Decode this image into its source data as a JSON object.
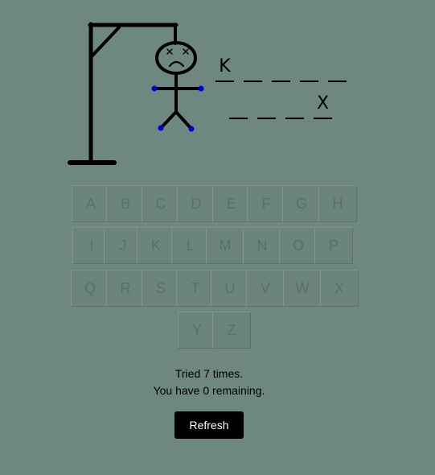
{
  "word": {
    "line1": [
      "K",
      "",
      "",
      "",
      ""
    ],
    "line2": [
      "",
      "",
      "",
      "X"
    ]
  },
  "keyboard": {
    "rows": [
      [
        "A",
        "B",
        "C",
        "D",
        "E",
        "F",
        "G",
        "H"
      ],
      [
        "I",
        "J",
        "K",
        "L",
        "M",
        "N",
        "O",
        "P"
      ],
      [
        "Q",
        "R",
        "S",
        "T",
        "U",
        "V",
        "W",
        "X"
      ],
      [
        "Y",
        "Z"
      ]
    ]
  },
  "status": {
    "tried": "Tried 7 times.",
    "remaining": "You have 0 remaining."
  },
  "refresh_label": "Refresh",
  "colors": {
    "background": "#6f8781",
    "joint_dots": "#0000cc",
    "button": "#000000"
  }
}
